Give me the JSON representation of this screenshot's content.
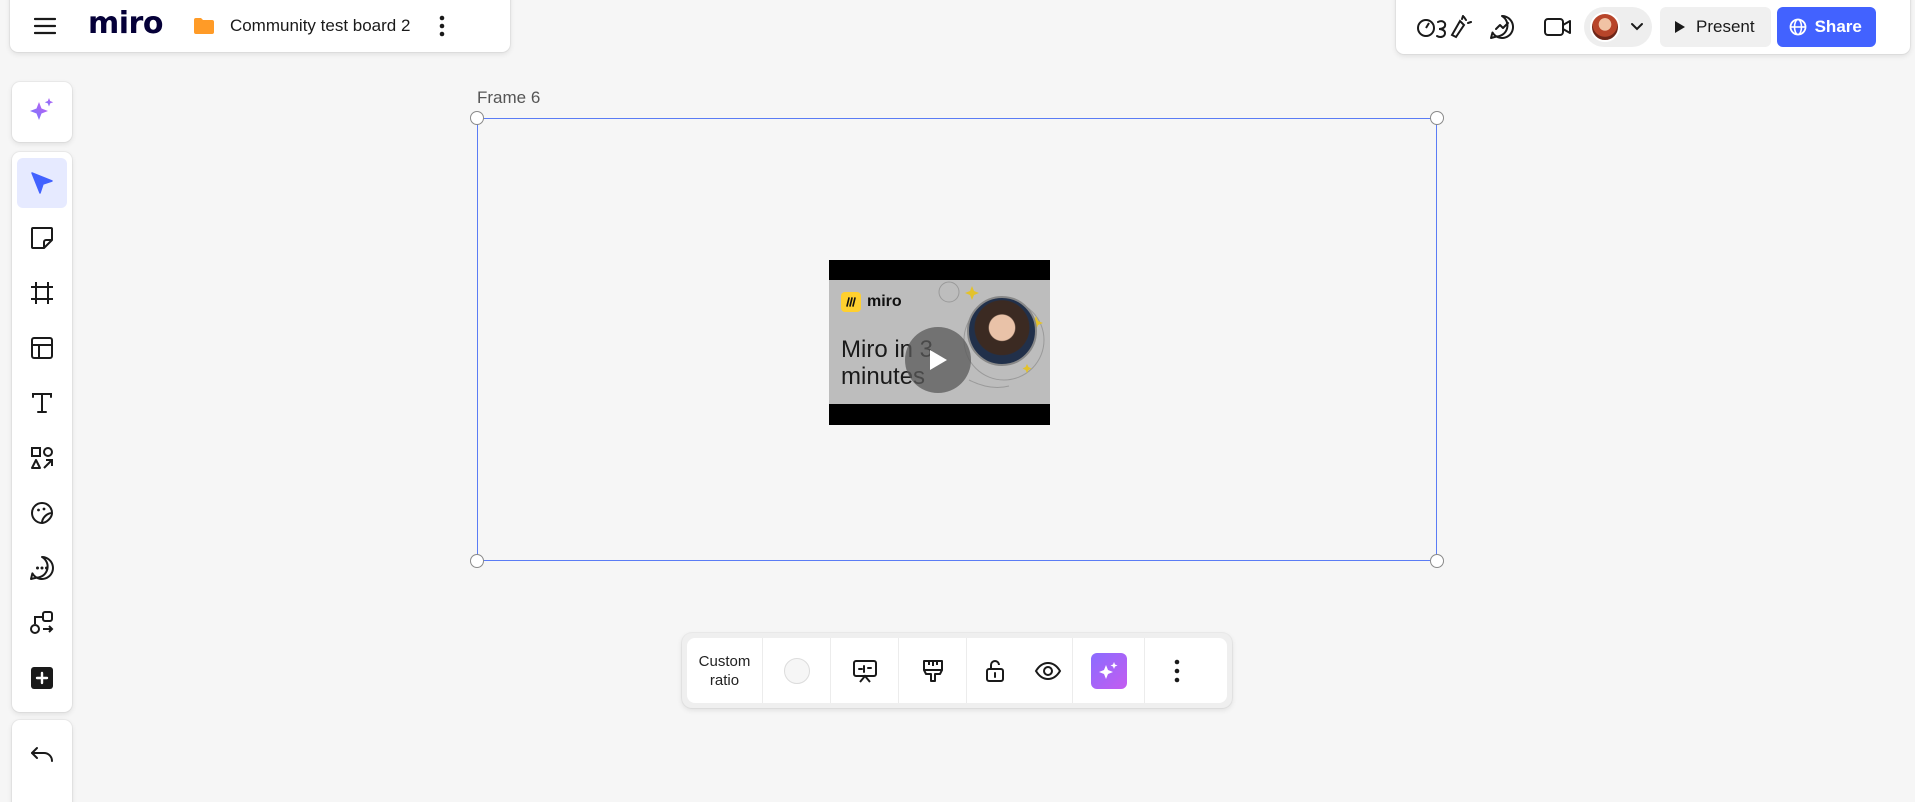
{
  "header": {
    "logo_text": "miro",
    "board_title": "Community test board 2",
    "folder_color": "#ff9b27"
  },
  "topright": {
    "reactions_icon": "reactions-icon",
    "present_label": "Present",
    "share_label": "Share",
    "accent": "#4262ff"
  },
  "left_toolbar": {
    "ai_icon": "sparkle-icon",
    "tools": [
      {
        "name": "select",
        "icon": "cursor-icon",
        "active": true
      },
      {
        "name": "sticky-note",
        "icon": "sticky-note-icon"
      },
      {
        "name": "frame",
        "icon": "frame-icon"
      },
      {
        "name": "templates",
        "icon": "templates-icon"
      },
      {
        "name": "text",
        "icon": "text-icon"
      },
      {
        "name": "shapes",
        "icon": "shapes-icon"
      },
      {
        "name": "stickers",
        "icon": "sticker-icon"
      },
      {
        "name": "comment",
        "icon": "comment-icon"
      },
      {
        "name": "diagram",
        "icon": "diagram-icon"
      },
      {
        "name": "more-tools",
        "icon": "plus-icon"
      }
    ],
    "undo_icon": "undo-icon"
  },
  "canvas": {
    "frame_label": "Frame 6",
    "frame_border_color": "#5b7cf5",
    "video": {
      "brand": "miro",
      "title": "Miro in 3 minutes"
    }
  },
  "context_toolbar": {
    "ratio_line1": "Custom",
    "ratio_line2": "ratio"
  }
}
